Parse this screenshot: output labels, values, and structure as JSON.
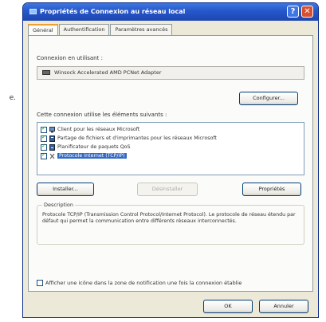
{
  "left_fragment": "e.",
  "window": {
    "title": "Propriétés de Connexion au réseau local",
    "help_glyph": "?",
    "close_glyph": "✕"
  },
  "tabs": [
    {
      "label": "Général",
      "active": true
    },
    {
      "label": "Authentification",
      "active": false
    },
    {
      "label": "Paramètres avancés",
      "active": false
    }
  ],
  "connect_using_label": "Connexion en utilisant :",
  "adapter_name": "Winsock Accelerated AMD PCNet Adapter",
  "configure_button": "Configurer...",
  "components_label": "Cette connexion utilise les éléments suivants :",
  "components": [
    {
      "label": "Client pour les réseaux Microsoft",
      "checked": true,
      "selected": false,
      "icon": "client-icon"
    },
    {
      "label": "Partage de fichiers et d'imprimantes pour les réseaux Microsoft",
      "checked": true,
      "selected": false,
      "icon": "service-icon"
    },
    {
      "label": "Planificateur de paquets QoS",
      "checked": true,
      "selected": false,
      "icon": "service-icon"
    },
    {
      "label": "Protocole Internet (TCP/IP)",
      "checked": true,
      "selected": true,
      "icon": "protocol-icon"
    }
  ],
  "buttons": {
    "install": "Installer...",
    "uninstall": "Désinstaller",
    "properties": "Propriétés"
  },
  "description": {
    "legend": "Description",
    "text": "Protocole TCP/IP (Transmission Control Protocol/Internet Protocol). Le protocole de réseau étendu par défaut qui permet la communication entre différents réseaux interconnectés."
  },
  "notify_label": "Afficher une icône dans la zone de notification une fois la connexion établie",
  "notify_checked": false,
  "ok_button": "OK",
  "cancel_button": "Annuler",
  "colors": {
    "titlebar": "#2657c9",
    "dialog_bg": "#ece9d8",
    "selection": "#316ac5"
  }
}
